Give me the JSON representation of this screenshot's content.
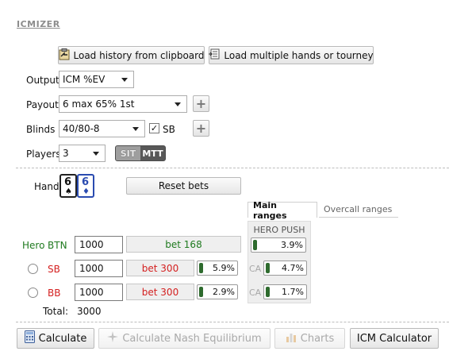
{
  "app": {
    "logo": "ICMIZER"
  },
  "toolbar": {
    "load_history_label": "Load history from clipboard",
    "load_multiple_label": "Load multiple hands or tourney"
  },
  "settings": {
    "output_label": "Output",
    "output_value": "ICM %EV",
    "payout_label": "Payout",
    "payout_value": "6 max 65% 1st",
    "blinds_label": "Blinds",
    "blinds_value": "40/80-8",
    "sb_checkbox_label": "SB",
    "sb_checked": "✓",
    "players_label": "Players",
    "players_value": "3",
    "mode_sng": "SIT",
    "mode_mtt": "MTT"
  },
  "hand": {
    "label": "Hand",
    "cards": [
      {
        "rank": "6",
        "suit": "♠",
        "color": "#111111"
      },
      {
        "rank": "6",
        "suit": "♦",
        "color": "#2a4bb0"
      }
    ],
    "reset_bets_label": "Reset bets"
  },
  "tabs": {
    "main_ranges": "Main ranges",
    "overcall_ranges": "Overcall ranges",
    "hero_push_header": "HERO PUSH"
  },
  "players": [
    {
      "prefix": "Hero",
      "position": "BTN",
      "stack": "1000",
      "bet": "bet 168",
      "bet_pct": "",
      "ca": "",
      "range_pct": "3.9%",
      "color": "#1f7a1f"
    },
    {
      "prefix": "",
      "position": "SB",
      "stack": "1000",
      "bet": "bet 300",
      "bet_pct": "5.9%",
      "ca": "CA",
      "range_pct": "4.7%",
      "color": "#d42020"
    },
    {
      "prefix": "",
      "position": "BB",
      "stack": "1000",
      "bet": "bet 300",
      "bet_pct": "2.9%",
      "ca": "CA",
      "range_pct": "1.7%",
      "color": "#d42020"
    }
  ],
  "total": {
    "label": "Total:",
    "value": "3000"
  },
  "actions": {
    "calculate": "Calculate",
    "nash": "Calculate Nash Equilibrium",
    "charts": "Charts",
    "icm_calculator": "ICM Calculator"
  }
}
